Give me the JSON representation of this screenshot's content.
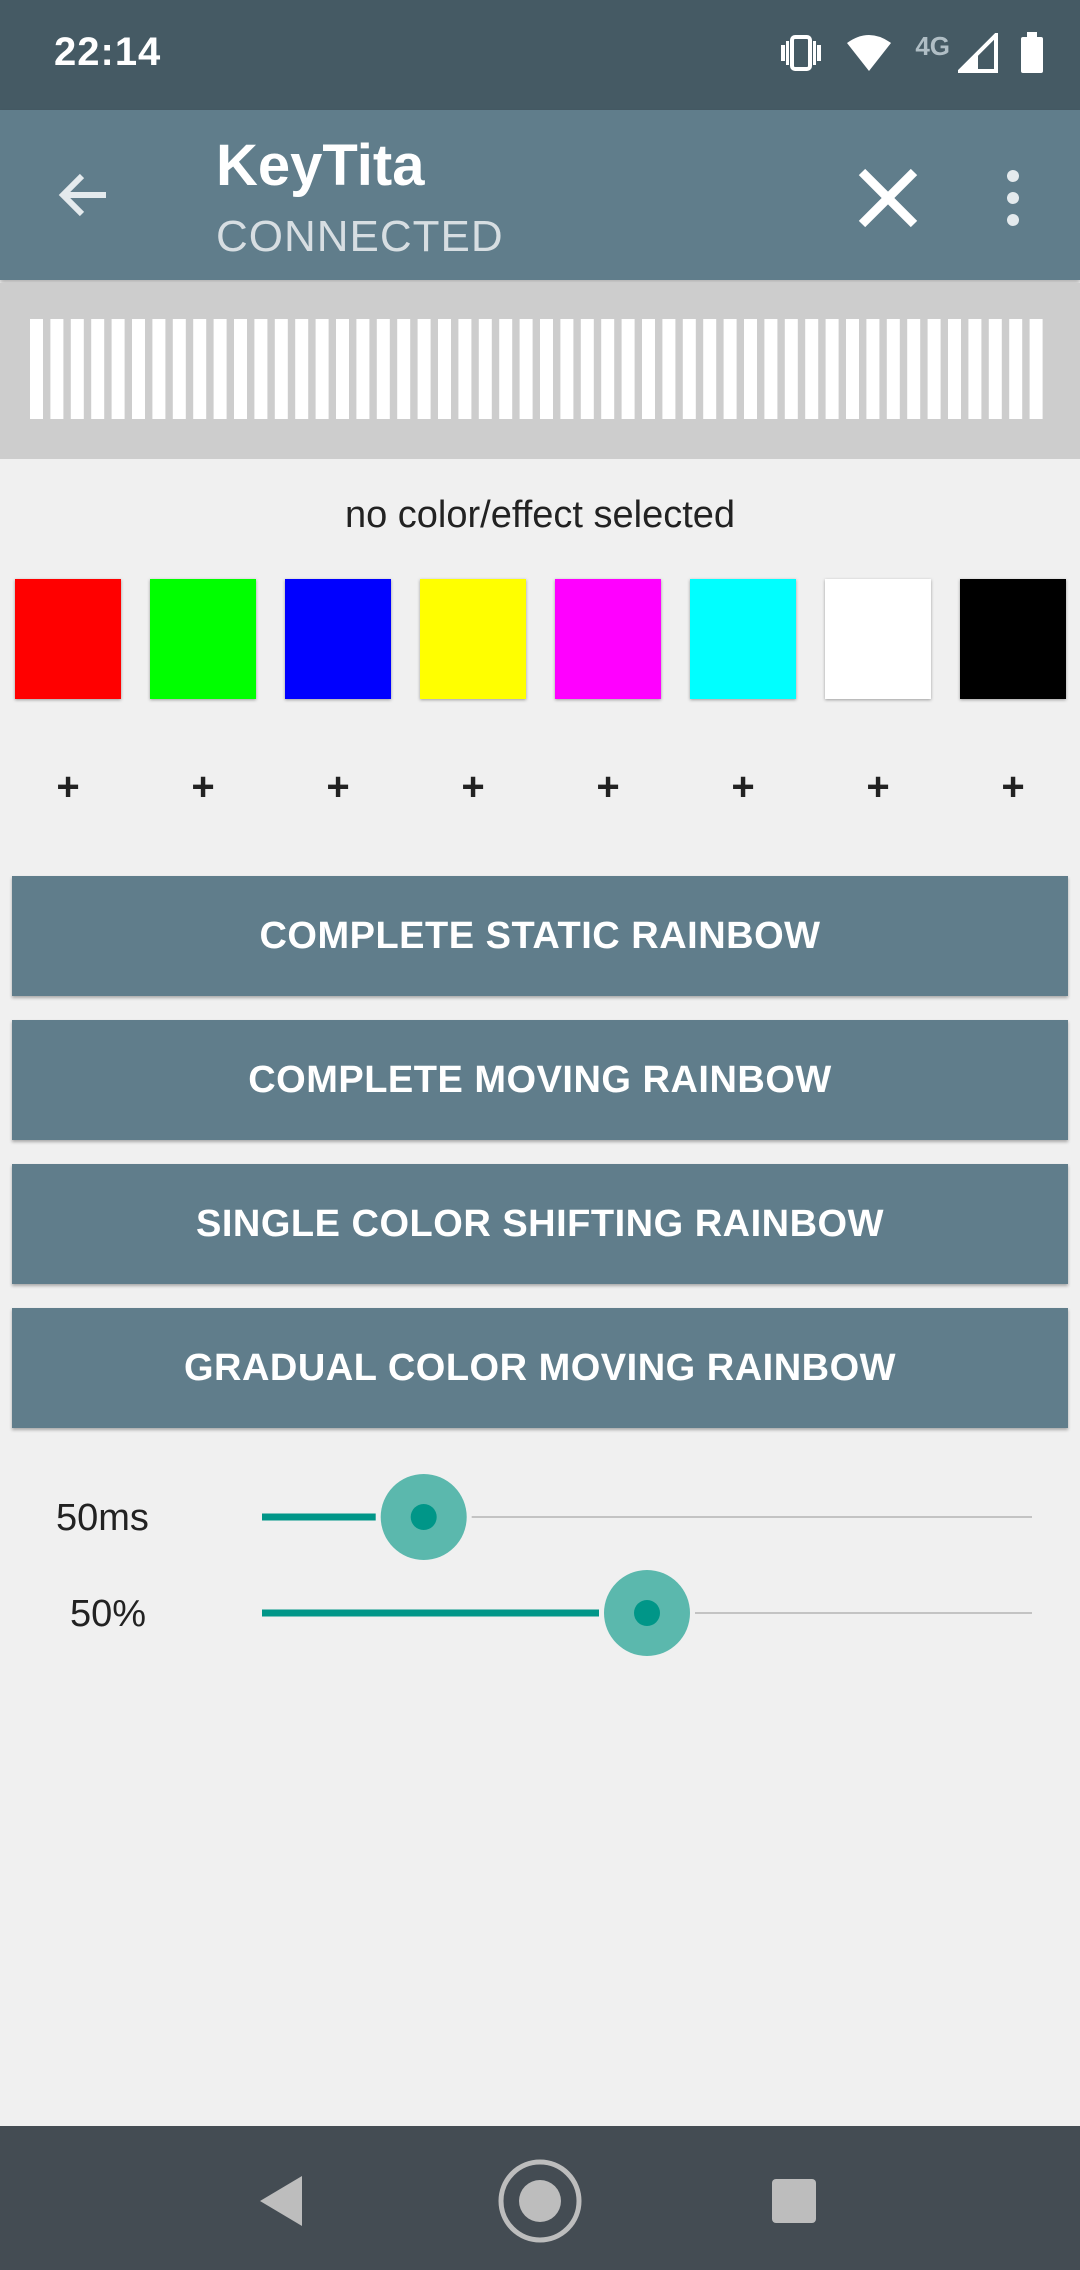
{
  "status_bar": {
    "time": "22:14",
    "network_label": "4G",
    "icons": [
      "vibrate-icon",
      "wifi-icon",
      "signal-icon",
      "battery-icon"
    ]
  },
  "app_bar": {
    "title": "KeyTita",
    "subtitle": "CONNECTED",
    "background": "#607d8b"
  },
  "selection": {
    "label": "no color/effect selected"
  },
  "swatches": [
    {
      "color": "#ff0000",
      "plus": "+"
    },
    {
      "color": "#00ff00",
      "plus": "+"
    },
    {
      "color": "#0000ff",
      "plus": "+"
    },
    {
      "color": "#ffff00",
      "plus": "+"
    },
    {
      "color": "#ff00ff",
      "plus": "+"
    },
    {
      "color": "#00ffff",
      "plus": "+"
    },
    {
      "color": "#ffffff",
      "plus": "+"
    },
    {
      "color": "#000000",
      "plus": "+"
    }
  ],
  "effects": [
    "COMPLETE STATIC RAINBOW",
    "COMPLETE MOVING RAINBOW",
    "SINGLE COLOR SHIFTING RAINBOW",
    "GRADUAL COLOR MOVING RAINBOW"
  ],
  "sliders": [
    {
      "label": "50ms",
      "fraction": 0.21
    },
    {
      "label": "50%",
      "fraction": 0.5
    }
  ],
  "accent_color": "#009688",
  "nav": [
    "back-nav-icon",
    "home-nav-icon",
    "recents-nav-icon"
  ]
}
